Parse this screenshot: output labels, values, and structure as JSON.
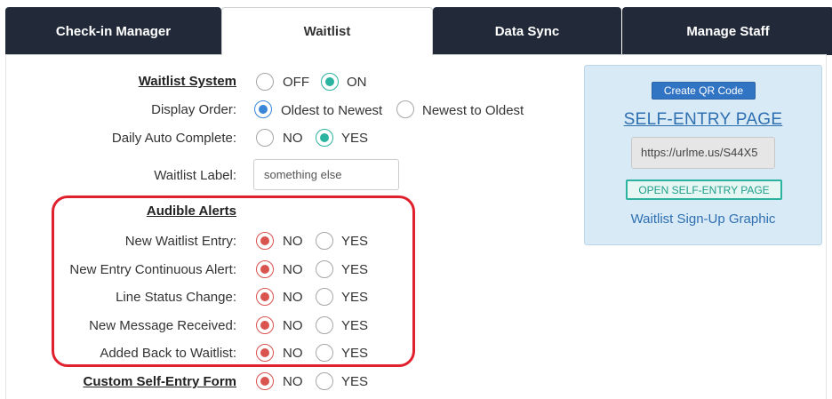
{
  "tabs": [
    {
      "label": "Check-in Manager",
      "active": false
    },
    {
      "label": "Waitlist",
      "active": true
    },
    {
      "label": "Data Sync",
      "active": false
    },
    {
      "label": "Manage Staff",
      "active": false
    }
  ],
  "settings": {
    "waitlist_system": {
      "label": "Waitlist System",
      "options": [
        "OFF",
        "ON"
      ],
      "selected": "ON"
    },
    "display_order": {
      "label": "Display Order:",
      "options": [
        "Oldest to Newest",
        "Newest to Oldest"
      ],
      "selected": "Oldest to Newest"
    },
    "daily_auto_complete": {
      "label": "Daily Auto Complete:",
      "options": [
        "NO",
        "YES"
      ],
      "selected": "YES"
    },
    "waitlist_label": {
      "label": "Waitlist Label:",
      "value": "something else"
    }
  },
  "audible_alerts": {
    "heading": "Audible Alerts",
    "items": [
      {
        "label": "New Waitlist Entry:",
        "no": "NO",
        "yes": "YES",
        "selected": "NO"
      },
      {
        "label": "New Entry Continuous Alert:",
        "no": "NO",
        "yes": "YES",
        "selected": "NO"
      },
      {
        "label": "Line Status Change:",
        "no": "NO",
        "yes": "YES",
        "selected": "NO"
      },
      {
        "label": "New Message Received:",
        "no": "NO",
        "yes": "YES",
        "selected": "NO"
      },
      {
        "label": "Added Back to Waitlist:",
        "no": "NO",
        "yes": "YES",
        "selected": "NO"
      }
    ]
  },
  "custom_form": {
    "label": "Custom Self-Entry Form",
    "no": "NO",
    "yes": "YES",
    "selected": "NO"
  },
  "self_entry": {
    "qr_button": "Create QR Code",
    "title": "SELF-ENTRY PAGE",
    "url": "https://urlme.us/S44X5",
    "open_button": "OPEN SELF-ENTRY PAGE",
    "graphic_link": "Waitlist Sign-Up Graphic"
  },
  "colors": {
    "tab_bg": "#222a3a",
    "teal": "#2bb3a0",
    "blue": "#3a86d8",
    "red": "#d9534f",
    "highlight": "#e0202c"
  }
}
